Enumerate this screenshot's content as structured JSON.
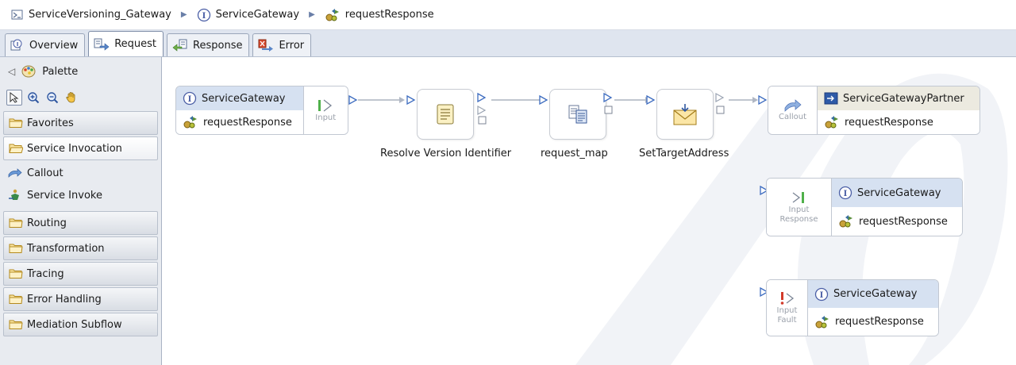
{
  "breadcrumb": {
    "items": [
      "ServiceVersioning_Gateway",
      "ServiceGateway",
      "requestResponse"
    ]
  },
  "tabs": [
    {
      "label": "Overview"
    },
    {
      "label": "Request"
    },
    {
      "label": "Response"
    },
    {
      "label": "Error"
    }
  ],
  "palette": {
    "title": "Palette",
    "drawers": {
      "favorites": "Favorites",
      "service_invocation": "Service Invocation",
      "routing": "Routing",
      "transformation": "Transformation",
      "tracing": "Tracing",
      "error_handling": "Error Handling",
      "mediation_subflow": "Mediation Subflow"
    },
    "entries": {
      "callout": "Callout",
      "service_invoke": "Service Invoke"
    }
  },
  "flow": {
    "input_node": {
      "interface": "ServiceGateway",
      "operation": "requestResponse",
      "terminal": "Input"
    },
    "primitives": [
      {
        "label": "Resolve Version Identifier"
      },
      {
        "label": "request_map"
      },
      {
        "label": "SetTargetAddress"
      }
    ],
    "callout_node": {
      "terminal": "Callout",
      "partner": "ServiceGatewayPartner",
      "operation": "requestResponse"
    },
    "input_response_node": {
      "terminal_line1": "Input",
      "terminal_line2": "Response",
      "interface": "ServiceGateway",
      "operation": "requestResponse"
    },
    "input_fault_node": {
      "terminal_line1": "Input",
      "terminal_line2": "Fault",
      "interface": "ServiceGateway",
      "operation": "requestResponse"
    }
  },
  "colors": {
    "accent_blue": "#4a6fb5",
    "header_blue": "#d6e1f1",
    "watermark": "#eceff5"
  }
}
